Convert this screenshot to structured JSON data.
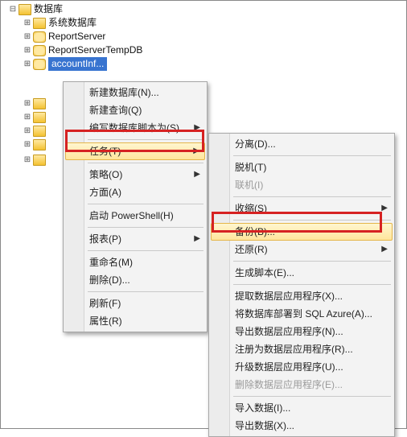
{
  "tree": {
    "root": "数据库",
    "children": [
      "系统数据库",
      "ReportServer",
      "ReportServerTempDB"
    ],
    "selected": "accountInf...",
    "exp_plus": "⊞",
    "exp_minus": "⊟"
  },
  "menu1": {
    "items": [
      {
        "label": "新建数据库(N)...",
        "sub": false
      },
      {
        "label": "新建查询(Q)",
        "sub": false
      },
      {
        "label": "编写数据库脚本为(S)",
        "sub": true
      }
    ],
    "tasks": "任务(T)",
    "items2": [
      {
        "label": "策略(O)",
        "sub": true
      },
      {
        "label": "方面(A)",
        "sub": false
      }
    ],
    "items3": [
      {
        "label": "启动 PowerShell(H)",
        "sub": false
      }
    ],
    "items4": [
      {
        "label": "报表(P)",
        "sub": true
      }
    ],
    "items5": [
      {
        "label": "重命名(M)",
        "sub": false
      },
      {
        "label": "删除(D)...",
        "sub": false
      }
    ],
    "items6": [
      {
        "label": "刷新(F)",
        "sub": false
      },
      {
        "label": "属性(R)",
        "sub": false
      }
    ]
  },
  "menu2": {
    "g1": [
      {
        "label": "分离(D)...",
        "sub": false
      }
    ],
    "g2": [
      {
        "label": "脱机(T)",
        "sub": false
      },
      {
        "label": "联机(I)",
        "sub": false,
        "disabled": true
      }
    ],
    "g3": [
      {
        "label": "收缩(S)",
        "sub": true
      }
    ],
    "backup": "备份(B)...",
    "g4": [
      {
        "label": "还原(R)",
        "sub": true
      }
    ],
    "g5": [
      {
        "label": "生成脚本(E)...",
        "sub": false
      }
    ],
    "g6": [
      {
        "label": "提取数据层应用程序(X)...",
        "sub": false
      },
      {
        "label": "将数据库部署到 SQL Azure(A)...",
        "sub": false
      },
      {
        "label": "导出数据层应用程序(N)...",
        "sub": false
      },
      {
        "label": "注册为数据层应用程序(R)...",
        "sub": false
      },
      {
        "label": "升级数据层应用程序(U)...",
        "sub": false
      },
      {
        "label": "删除数据层应用程序(E)...",
        "sub": false,
        "disabled": true
      }
    ],
    "g7": [
      {
        "label": "导入数据(I)...",
        "sub": false
      },
      {
        "label": "导出数据(X)...",
        "sub": false
      }
    ]
  }
}
